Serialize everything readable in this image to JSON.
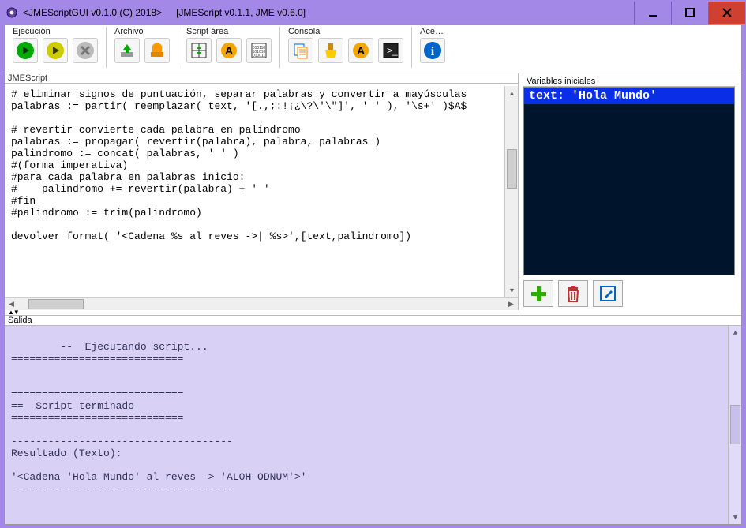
{
  "titlebar": {
    "main": "<JMEScriptGUI v0.1.0  (C) 2018>",
    "sub": "[JMEScript v0.1.1, JME v0.6.0]"
  },
  "toolbar": {
    "groups": {
      "ejecucion": "Ejecución",
      "archivo": "Archivo",
      "script": "Script área",
      "consola": "Consola",
      "acerca": "Ace…"
    }
  },
  "script": {
    "title": "JMEScript",
    "code": "# eliminar signos de puntuación, separar palabras y convertir a mayúsculas\npalabras := partir( reemplazar( text, '[.,;:!¡¿\\?\\'\\\"]', ' ' ), '\\s+' )$A$\n\n# revertir convierte cada palabra en palíndromo\npalabras := propagar( revertir(palabra), palabra, palabras )\npalindromo := concat( palabras, ' ' )\n#(forma imperativa)\n#para cada palabra en palabras inicio:\n#    palindromo += revertir(palabra) + ' '\n#fin\n#palindromo := trim(palindromo)\n\ndevolver format( '<Cadena %s al reves ->| %s>',[text,palindromo])"
  },
  "vars": {
    "title": "Variables iniciales",
    "selected": "text:  'Hola Mundo'"
  },
  "output": {
    "title": "Salida",
    "text": "--  Ejecutando script...\n============================\n\n\n============================\n==  Script terminado\n============================\n\n------------------------------------\nResultado (Texto):\n\n'<Cadena 'Hola Mundo' al reves -> 'ALOH ODNUM'>'\n------------------------------------"
  }
}
